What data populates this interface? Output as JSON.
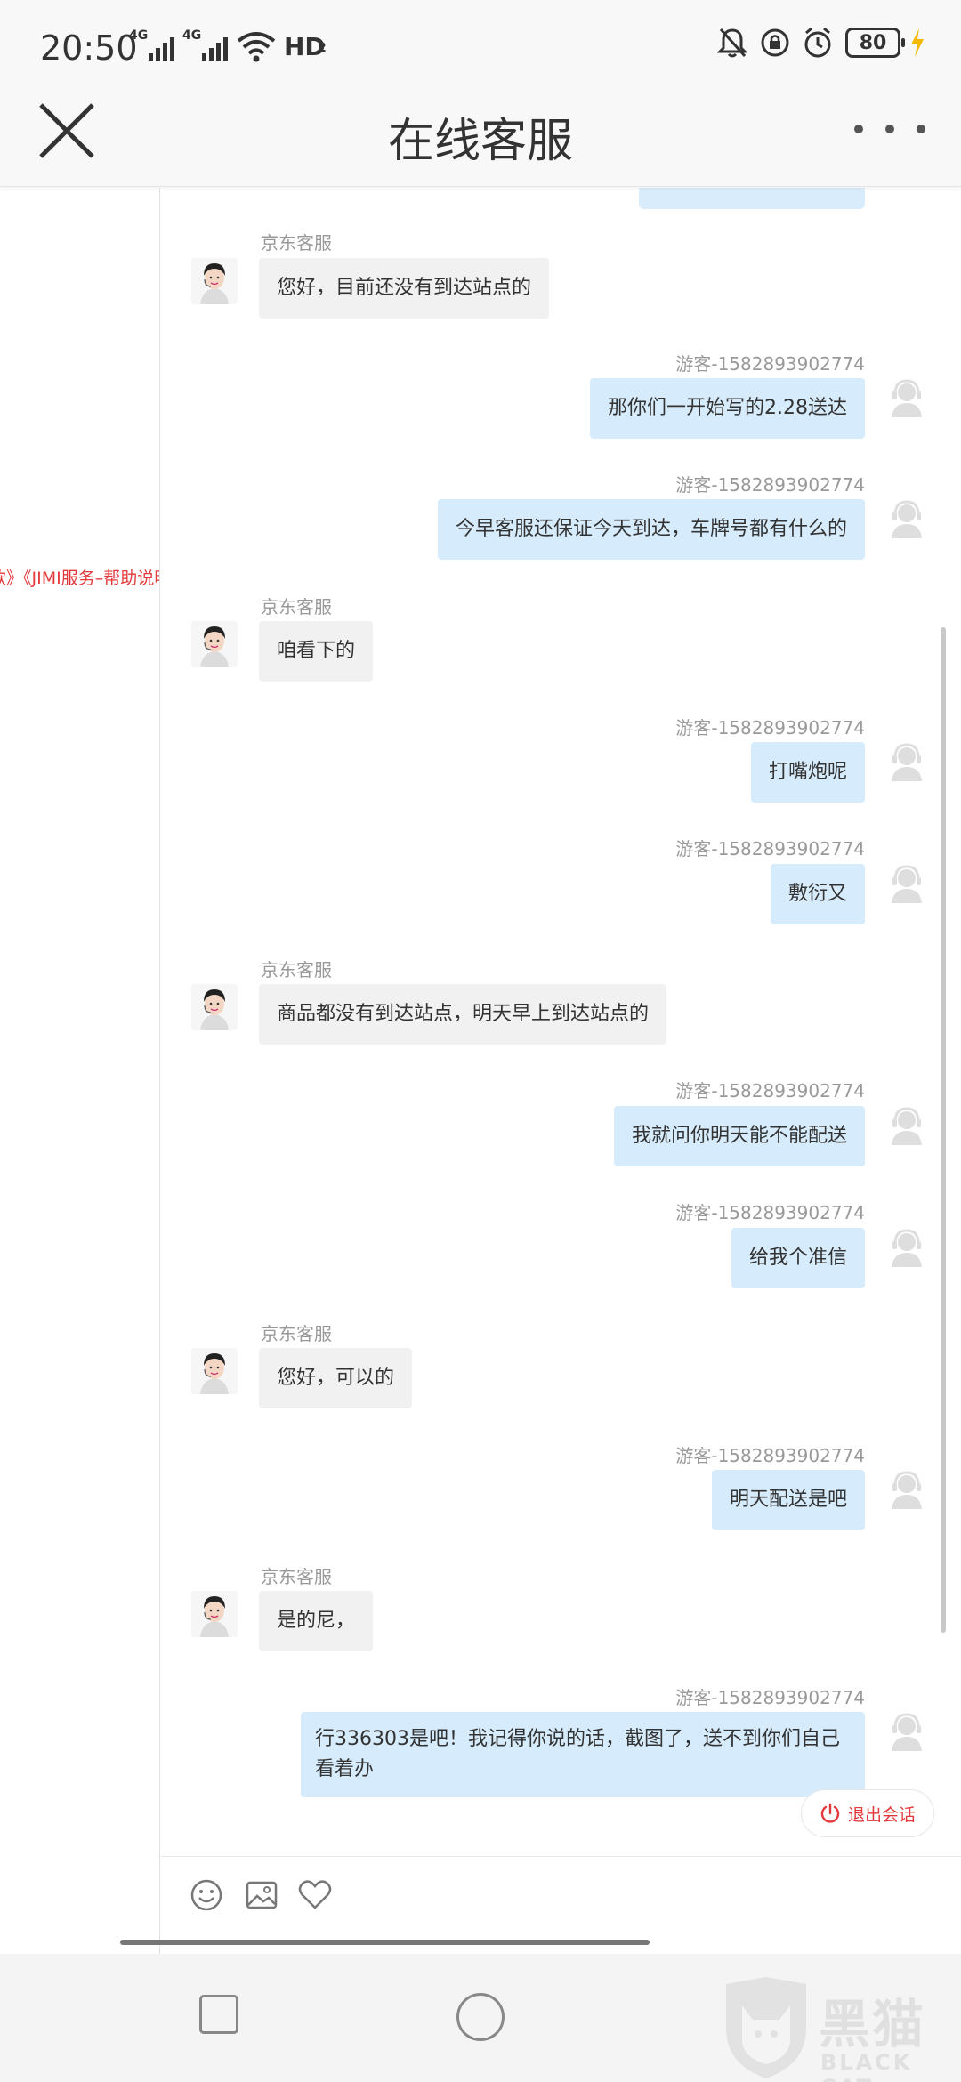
{
  "status_bar": {
    "time": "20:50",
    "network_1": "4G",
    "network_2": "4G",
    "hd_label": "HD",
    "hd_sub": "2",
    "battery": "80"
  },
  "header": {
    "title": "在线客服"
  },
  "left_panel": {
    "link_text": "款》《JIMI服务–帮助说明》"
  },
  "messages": [
    {
      "side": "left",
      "name": "京东客服",
      "text": "您好，目前还没有到达站点的"
    },
    {
      "side": "right",
      "name": "游客-1582893902774",
      "text": "那你们一开始写的2.28送达"
    },
    {
      "side": "right",
      "name": "游客-1582893902774",
      "text": "今早客服还保证今天到达，车牌号都有什么的"
    },
    {
      "side": "left",
      "name": "京东客服",
      "text": "咱看下的"
    },
    {
      "side": "right",
      "name": "游客-1582893902774",
      "text": "打嘴炮呢"
    },
    {
      "side": "right",
      "name": "游客-1582893902774",
      "text": "敷衍又"
    },
    {
      "side": "left",
      "name": "京东客服",
      "text": "商品都没有到达站点，明天早上到达站点的"
    },
    {
      "side": "right",
      "name": "游客-1582893902774",
      "text": "我就问你明天能不能配送"
    },
    {
      "side": "right",
      "name": "游客-1582893902774",
      "text": "给我个准信"
    },
    {
      "side": "left",
      "name": "京东客服",
      "text": "您好，可以的"
    },
    {
      "side": "right",
      "name": "游客-1582893902774",
      "text": "明天配送是吧"
    },
    {
      "side": "left",
      "name": "京东客服",
      "text": "是的尼，"
    },
    {
      "side": "right",
      "name": "游客-1582893902774",
      "text": "行336303是吧！我记得你说的话，截图了，送不到你们自己看着办"
    }
  ],
  "exit_button": {
    "label": "退出会话"
  },
  "input_bar": {
    "icons": [
      "emoji-icon",
      "image-icon",
      "heart-icon"
    ]
  },
  "watermark": {
    "cn": "黑猫",
    "en": "BLACK CAT"
  },
  "colors": {
    "accent_red": "#e4393c",
    "user_bubble": "#d6ebfb",
    "agent_bubble": "#f1f1f1"
  }
}
